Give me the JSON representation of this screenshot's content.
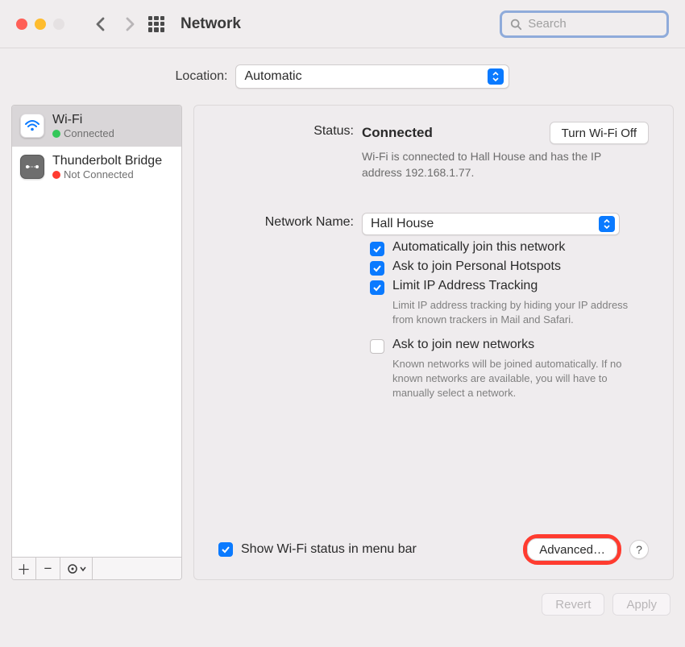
{
  "window": {
    "title": "Network",
    "search_placeholder": "Search"
  },
  "location": {
    "label": "Location:",
    "value": "Automatic"
  },
  "services": [
    {
      "name": "Wi-Fi",
      "status": "Connected",
      "status_color": "green",
      "icon": "wifi",
      "selected": true
    },
    {
      "name": "Thunderbolt Bridge",
      "status": "Not Connected",
      "status_color": "red",
      "icon": "thunderbolt",
      "selected": false
    }
  ],
  "status": {
    "label": "Status:",
    "value": "Connected",
    "toggle_label": "Turn Wi-Fi Off",
    "hint": "Wi-Fi is connected to Hall House and has the IP address 192.168.1.77."
  },
  "network_name": {
    "label": "Network Name:",
    "value": "Hall House"
  },
  "options": {
    "auto_join": {
      "label": "Automatically join this network",
      "checked": true
    },
    "ask_hotspots": {
      "label": "Ask to join Personal Hotspots",
      "checked": true
    },
    "limit_ip": {
      "label": "Limit IP Address Tracking",
      "checked": true,
      "hint": "Limit IP address tracking by hiding your IP address from known trackers in Mail and Safari."
    },
    "ask_new": {
      "label": "Ask to join new networks",
      "checked": false,
      "hint": "Known networks will be joined automatically. If no known networks are available, you will have to manually select a network."
    }
  },
  "menubar": {
    "label": "Show Wi-Fi status in menu bar",
    "checked": true
  },
  "buttons": {
    "advanced": "Advanced…",
    "help": "?",
    "revert": "Revert",
    "apply": "Apply"
  }
}
